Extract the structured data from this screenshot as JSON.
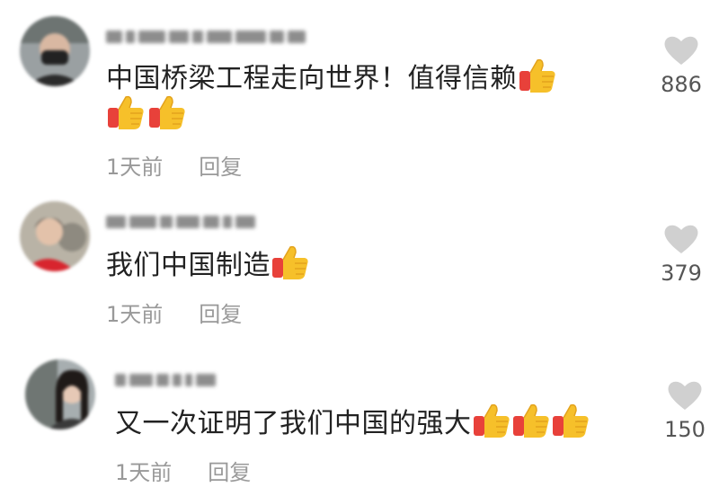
{
  "comments": [
    {
      "text": "中国桥梁工程走向世界！值得信赖",
      "time": "1天前",
      "reply": "回复",
      "likes": "886",
      "inline_thumbs": 1,
      "extra_thumbs": 2
    },
    {
      "text": "我们中国制造",
      "time": "1天前",
      "reply": "回复",
      "likes": "379",
      "inline_thumbs": 1,
      "extra_thumbs": 0
    },
    {
      "text": "又一次证明了我们中国的强大",
      "time": "1天前",
      "reply": "回复",
      "likes": "150",
      "inline_thumbs": 3,
      "extra_thumbs": 0
    }
  ],
  "colors": {
    "like_heart": "#d0d0d0",
    "text": "#222222",
    "meta": "#999999"
  },
  "icons": {
    "like": "heart-icon",
    "reaction": "thumbs-up-emoji"
  }
}
